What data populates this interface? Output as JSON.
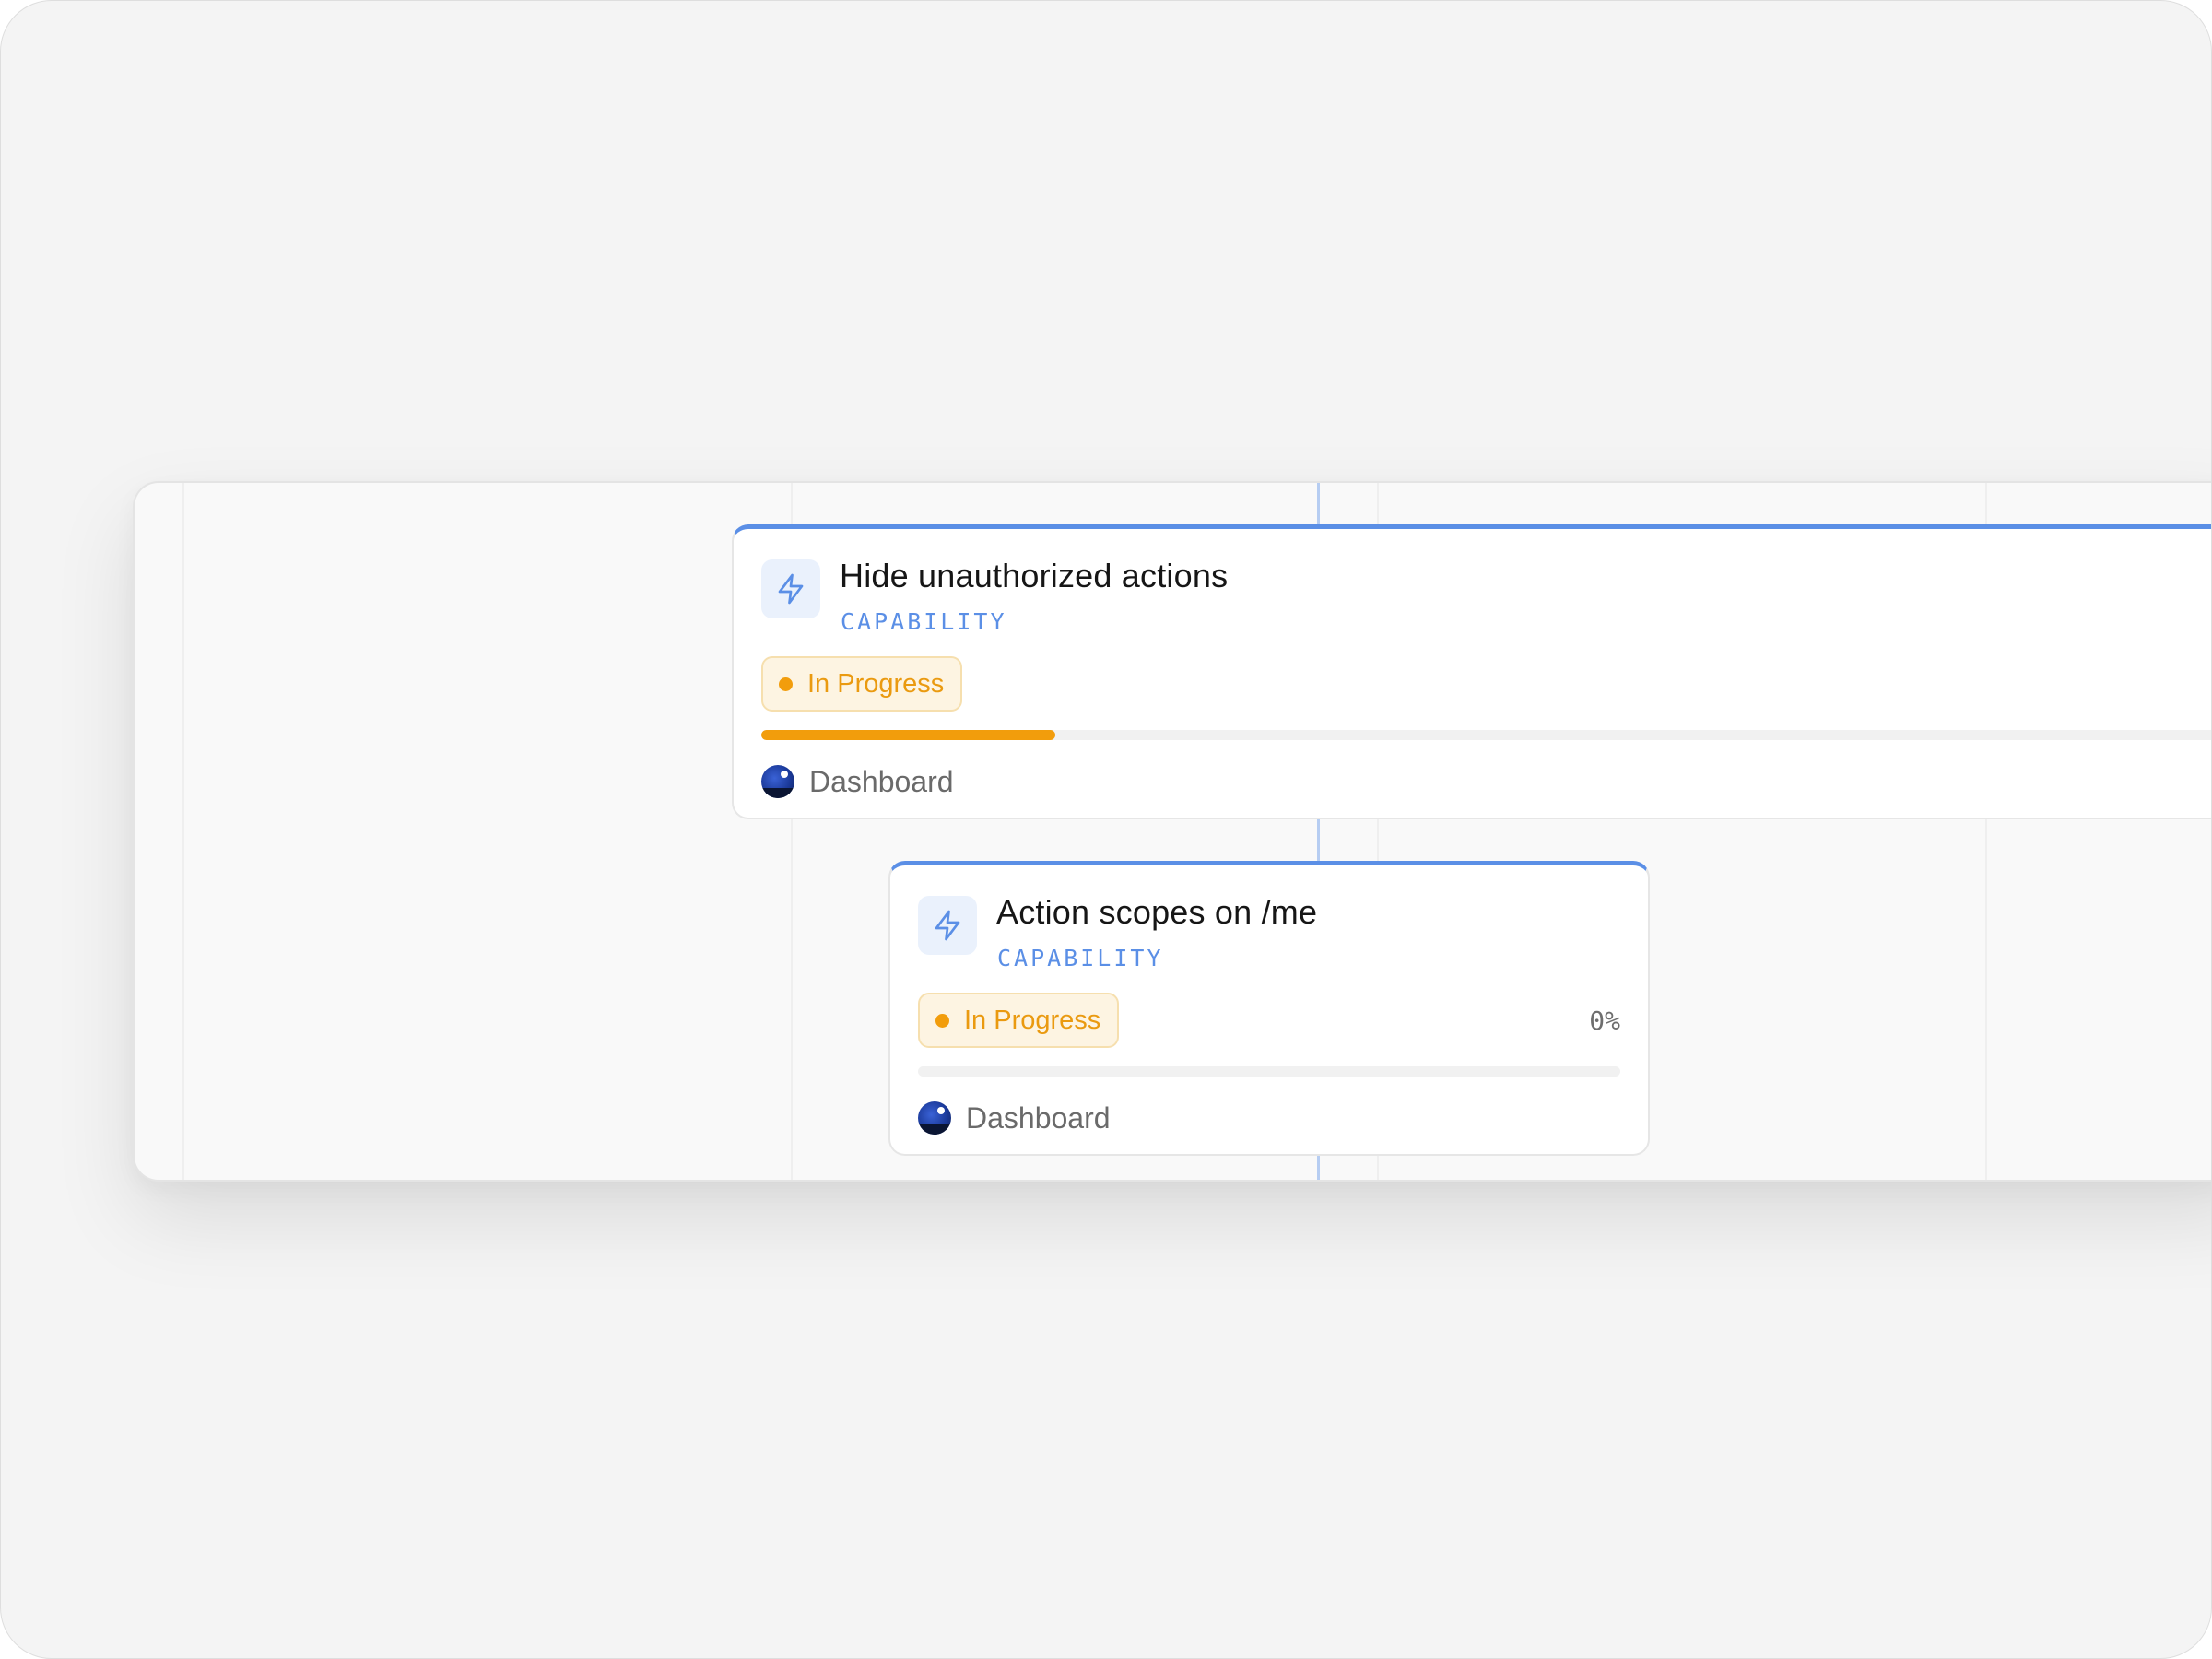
{
  "colors": {
    "accent": "#5b8fe6",
    "status_in_progress": "#f29d0c",
    "status_badge_bg": "#fdf4e2",
    "project_icon": "#1b3a9a"
  },
  "cards": [
    {
      "icon": "lightning-icon",
      "title": "Hide unauthorized actions",
      "type": "CAPABILITY",
      "status": "In Progress",
      "progress": 0.19,
      "project": "Dashboard",
      "project_icon": "project-avatar-icon"
    },
    {
      "icon": "lightning-icon",
      "title": "Action scopes on /me",
      "type": "CAPABILITY",
      "status": "In Progress",
      "progress": 0,
      "progress_label": "0%",
      "project": "Dashboard",
      "project_icon": "project-avatar-icon"
    }
  ]
}
